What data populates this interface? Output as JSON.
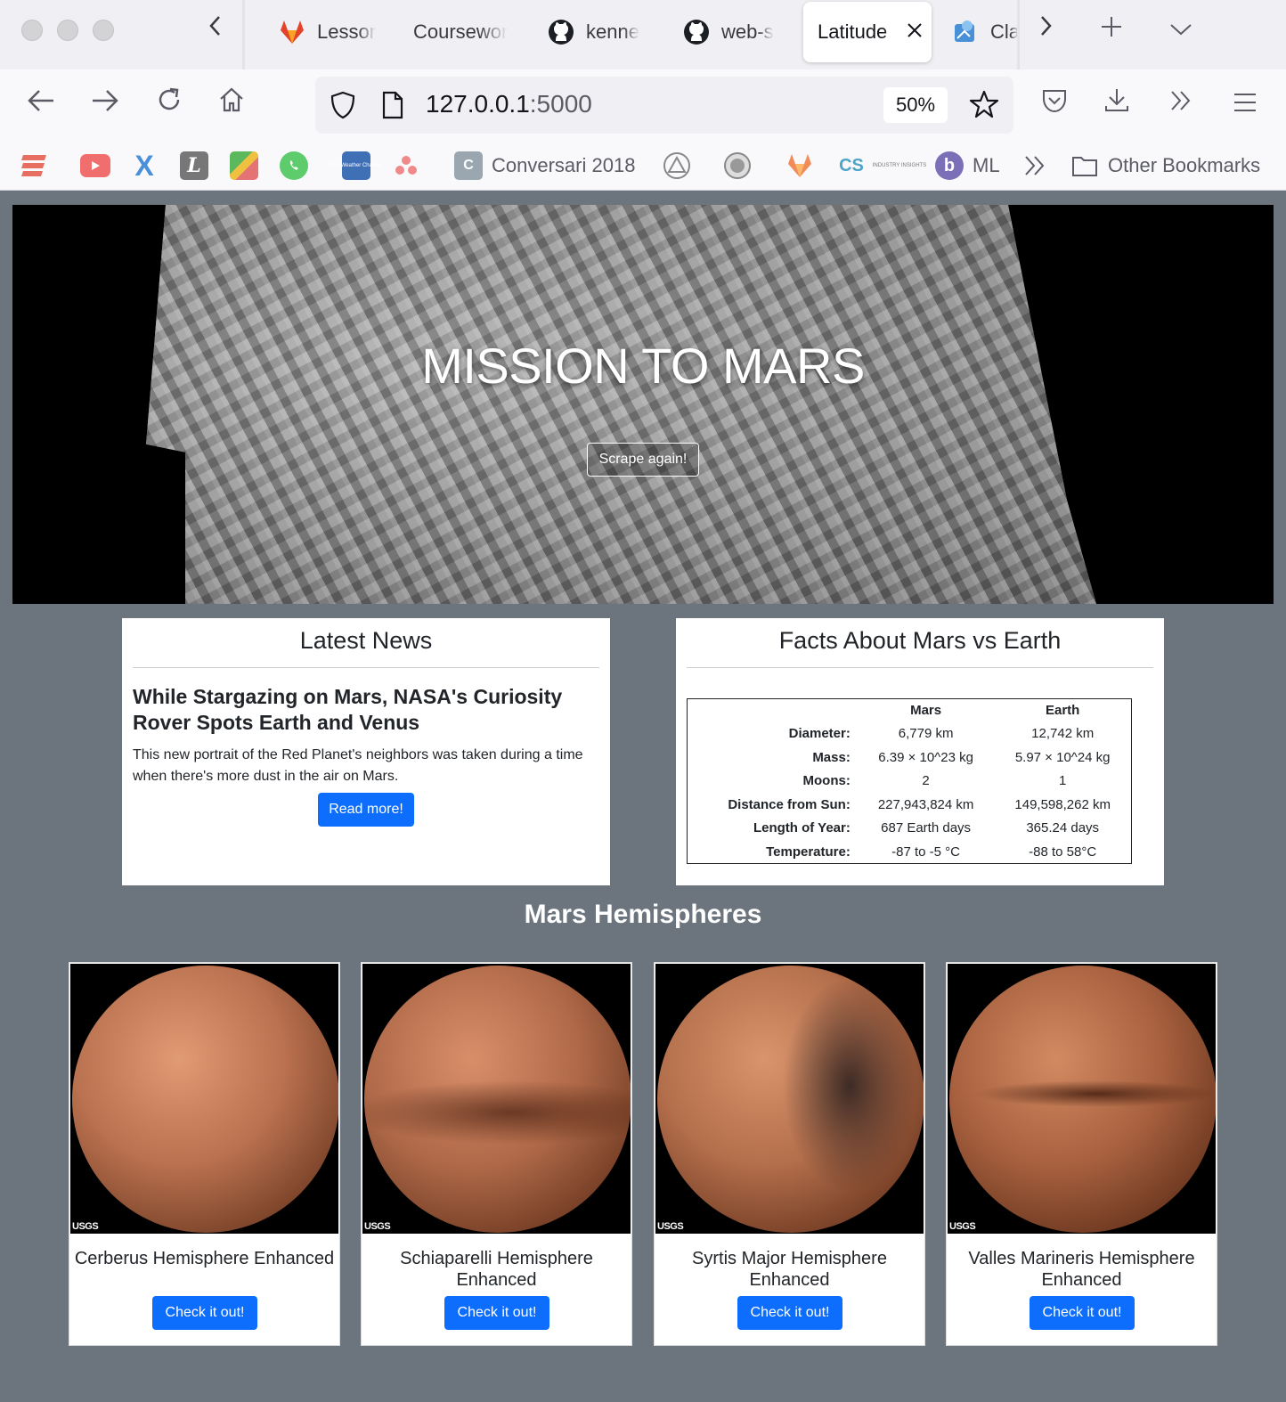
{
  "browser": {
    "tabs": [
      {
        "label": "Lessor",
        "icon": "gitlab-icon"
      },
      {
        "label": "Coursewor",
        "icon": ""
      },
      {
        "label": "kenne",
        "icon": "github-icon"
      },
      {
        "label": "web-s",
        "icon": "github-icon"
      },
      {
        "label": "Cla",
        "icon": "puzzle-icon"
      }
    ],
    "active_tab": {
      "label": "Latitude"
    },
    "url_host": "127.0.0.1",
    "url_port": ":5000",
    "zoom": "50%",
    "bookmarks": {
      "conversari": "Conversari 2018",
      "cs": "CS",
      "ml": "ML",
      "other": "Other Bookmarks"
    }
  },
  "jumbotron": {
    "title": "MISSION TO MARS",
    "button": "Scrape again!"
  },
  "news": {
    "heading": "Latest News",
    "title": "While Stargazing on Mars, NASA's Curiosity Rover Spots Earth and Venus",
    "teaser": "This new portrait of the Red Planet's neighbors was taken during a time when there's more dust in the air on Mars.",
    "button": "Read more!"
  },
  "facts": {
    "heading": "Facts About Mars vs Earth",
    "columns": [
      "Mars",
      "Earth"
    ],
    "rows": [
      {
        "label": "Diameter:",
        "mars": "6,779 km",
        "earth": "12,742 km"
      },
      {
        "label": "Mass:",
        "mars": "6.39 × 10^23 kg",
        "earth": "5.97 × 10^24 kg"
      },
      {
        "label": "Moons:",
        "mars": "2",
        "earth": "1"
      },
      {
        "label": "Distance from Sun:",
        "mars": "227,943,824 km",
        "earth": "149,598,262 km"
      },
      {
        "label": "Length of Year:",
        "mars": "687 Earth days",
        "earth": "365.24 days"
      },
      {
        "label": "Temperature:",
        "mars": "-87 to -5 °C",
        "earth": "-88 to 58°C"
      }
    ]
  },
  "hemispheres": {
    "heading": "Mars Hemispheres",
    "logo_text": "USGS",
    "items": [
      {
        "title": "Cerberus Hemisphere Enhanced",
        "button": "Check it out!"
      },
      {
        "title": "Schiaparelli Hemisphere Enhanced",
        "button": "Check it out!"
      },
      {
        "title": "Syrtis Major Hemisphere Enhanced",
        "button": "Check it out!"
      },
      {
        "title": "Valles Marineris Hemisphere Enhanced",
        "button": "Check it out!"
      }
    ]
  },
  "colors": {
    "page_bg": "#6c757d",
    "primary": "#0d6efd",
    "mars_surface": "#b9714f"
  }
}
